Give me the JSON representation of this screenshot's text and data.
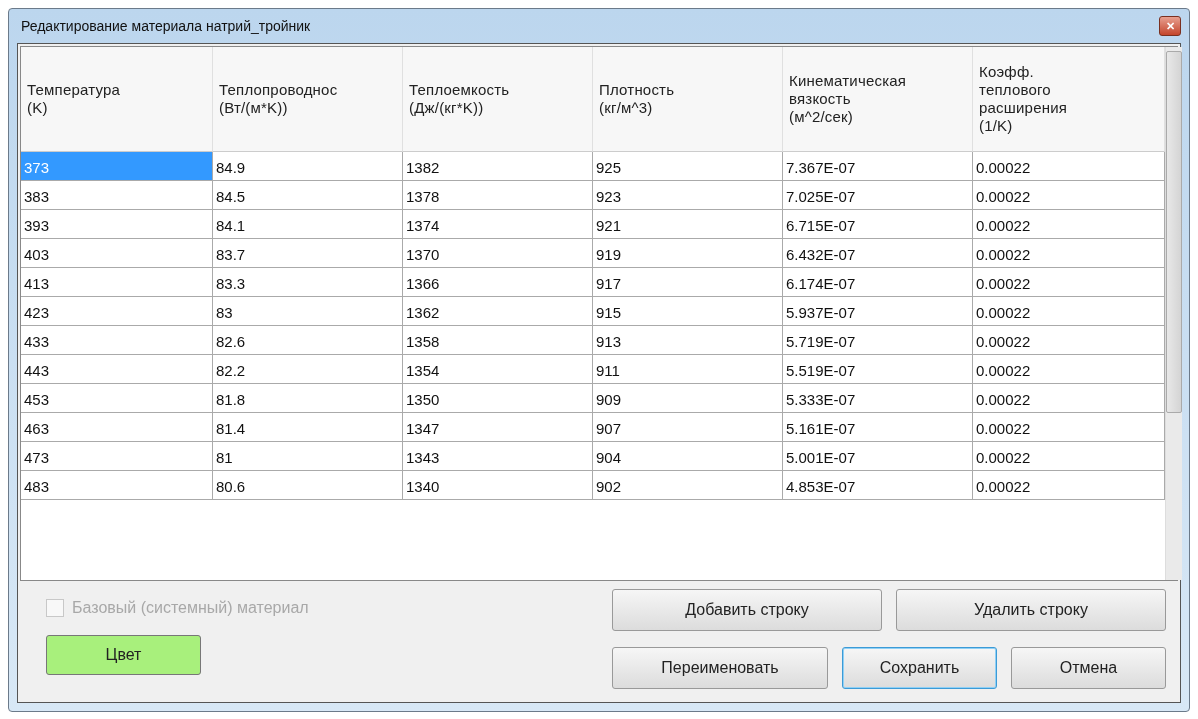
{
  "window": {
    "title": "Редактирование материала натрий_тройник",
    "close": "✕"
  },
  "table": {
    "columns": [
      "Температура\n(K)",
      "Теплопроводнос\n(Вт/(м*K))",
      "Теплоемкость\n(Дж/(кг*K))",
      "Плотность\n(кг/м^3)",
      "Кинематическая\nвязкость\n(м^2/сек)",
      "Коэфф.\nтеплового\nрасширения\n(1/K)"
    ],
    "rows": [
      {
        "selected": true,
        "cells": [
          "373",
          "84.9",
          "1382",
          "925",
          "7.367E-07",
          "0.00022"
        ]
      },
      {
        "selected": false,
        "cells": [
          "383",
          "84.5",
          "1378",
          "923",
          "7.025E-07",
          "0.00022"
        ]
      },
      {
        "selected": false,
        "cells": [
          "393",
          "84.1",
          "1374",
          "921",
          "6.715E-07",
          "0.00022"
        ]
      },
      {
        "selected": false,
        "cells": [
          "403",
          "83.7",
          "1370",
          "919",
          "6.432E-07",
          "0.00022"
        ]
      },
      {
        "selected": false,
        "cells": [
          "413",
          "83.3",
          "1366",
          "917",
          "6.174E-07",
          "0.00022"
        ]
      },
      {
        "selected": false,
        "cells": [
          "423",
          "83",
          "1362",
          "915",
          "5.937E-07",
          "0.00022"
        ]
      },
      {
        "selected": false,
        "cells": [
          "433",
          "82.6",
          "1358",
          "913",
          "5.719E-07",
          "0.00022"
        ]
      },
      {
        "selected": false,
        "cells": [
          "443",
          "82.2",
          "1354",
          "911",
          "5.519E-07",
          "0.00022"
        ]
      },
      {
        "selected": false,
        "cells": [
          "453",
          "81.8",
          "1350",
          "909",
          "5.333E-07",
          "0.00022"
        ]
      },
      {
        "selected": false,
        "cells": [
          "463",
          "81.4",
          "1347",
          "907",
          "5.161E-07",
          "0.00022"
        ]
      },
      {
        "selected": false,
        "cells": [
          "473",
          "81",
          "1343",
          "904",
          "5.001E-07",
          "0.00022"
        ]
      },
      {
        "selected": false,
        "cells": [
          "483",
          "80.6",
          "1340",
          "902",
          "4.853E-07",
          "0.00022"
        ]
      }
    ]
  },
  "base_material": {
    "label": "Базовый (системный) материал",
    "checked": false,
    "disabled": true
  },
  "color_button": {
    "label": "Цвет",
    "color": "#a8f07c"
  },
  "row_buttons": [
    {
      "label": "Добавить строку",
      "default": false
    },
    {
      "label": "Удалить строку",
      "default": false
    }
  ],
  "dialog_buttons": [
    {
      "label": "Переименовать",
      "default": false
    },
    {
      "label": "Сохранить",
      "default": true
    },
    {
      "label": "Отмена",
      "default": false
    }
  ]
}
